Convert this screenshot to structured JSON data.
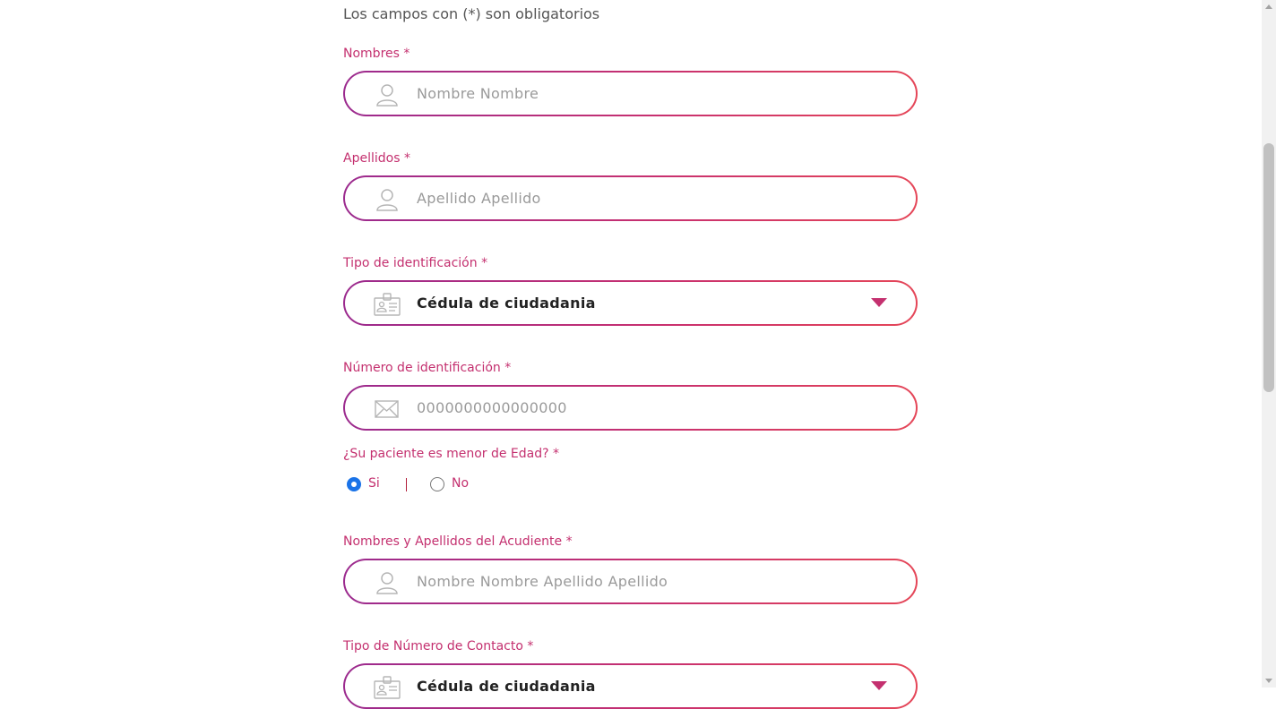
{
  "form": {
    "required_note": "Los campos con (*) son obligatorios",
    "nombres": {
      "label": "Nombres *",
      "placeholder": "Nombre Nombre",
      "icon": "user-icon"
    },
    "apellidos": {
      "label": "Apellidos *",
      "placeholder": "Apellido Apellido",
      "icon": "user-icon"
    },
    "tipo_identificacion": {
      "label": "Tipo de identificación *",
      "value": "Cédula de ciudadania",
      "icon": "id-card-icon"
    },
    "numero_identificacion": {
      "label": "Número de identificación *",
      "placeholder": "0000000000000000",
      "icon": "envelope-icon"
    },
    "menor_edad": {
      "label": "¿Su paciente es menor de Edad? *",
      "options": [
        {
          "label": "Si",
          "checked": true
        },
        {
          "label": "No",
          "checked": false
        }
      ]
    },
    "acudiente": {
      "label": "Nombres y Apellidos del Acudiente *",
      "placeholder": "Nombre Nombre Apellido Apellido",
      "icon": "user-icon"
    },
    "tipo_numero_contacto": {
      "label": "Tipo de Número de Contacto *",
      "value": "Cédula de ciudadania",
      "icon": "id-card-icon"
    }
  },
  "colors": {
    "label": "#c4306f",
    "border_start": "#9b2a8e",
    "border_end": "#e54658",
    "radio_checked": "#1a73e8"
  }
}
